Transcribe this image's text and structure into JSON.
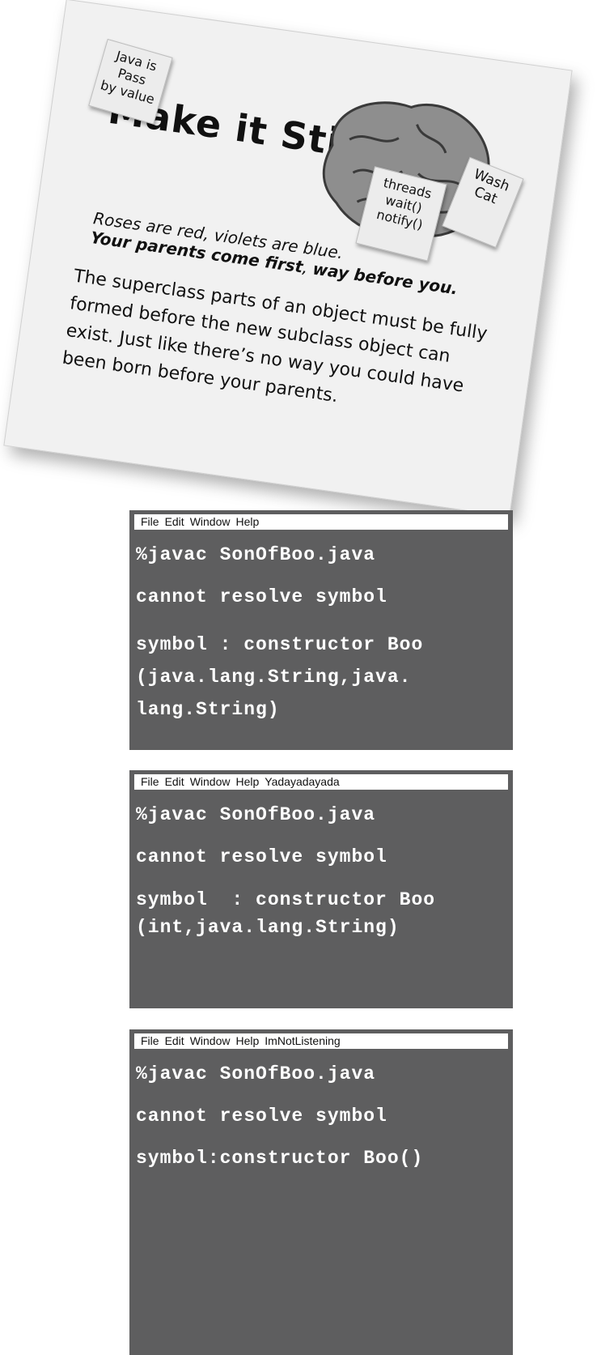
{
  "card": {
    "title": "Make it Stick",
    "sticky_notes": {
      "java": [
        "Java is",
        "Pass",
        "by value"
      ],
      "wash": [
        "Wash",
        "Cat"
      ],
      "threads": [
        "threads",
        "wait()",
        "notify()"
      ]
    },
    "poem_line1": "Roses are red, violets are blue.",
    "poem_line2_bold_a": "Your parents come first",
    "poem_line2_sep": ", ",
    "poem_line2_bold_b": "way before you",
    "poem_line2_end": ".",
    "body": "The superclass parts of an object must be fully formed before the new subclass object can exist.  Just like there’s no way you could have been born before your parents."
  },
  "windows": [
    {
      "menu": [
        "File",
        "Edit",
        "Window",
        "Help"
      ],
      "lines": [
        "%javac SonOfBoo.java",
        "cannot resolve symbol",
        "symbol : constructor Boo",
        "(java.lang.String,java.",
        "lang.String)"
      ]
    },
    {
      "menu": [
        "File",
        "Edit",
        "Window",
        "Help",
        "Yadayadayada"
      ],
      "lines": [
        "%javac SonOfBoo.java",
        "cannot resolve symbol",
        "symbol  : constructor Boo",
        "(int,java.lang.String)"
      ]
    },
    {
      "menu": [
        "File",
        "Edit",
        "Window",
        "Help",
        "ImNotListening"
      ],
      "lines": [
        "%javac SonOfBoo.java",
        "cannot resolve symbol",
        "symbol:constructor Boo()"
      ]
    }
  ]
}
